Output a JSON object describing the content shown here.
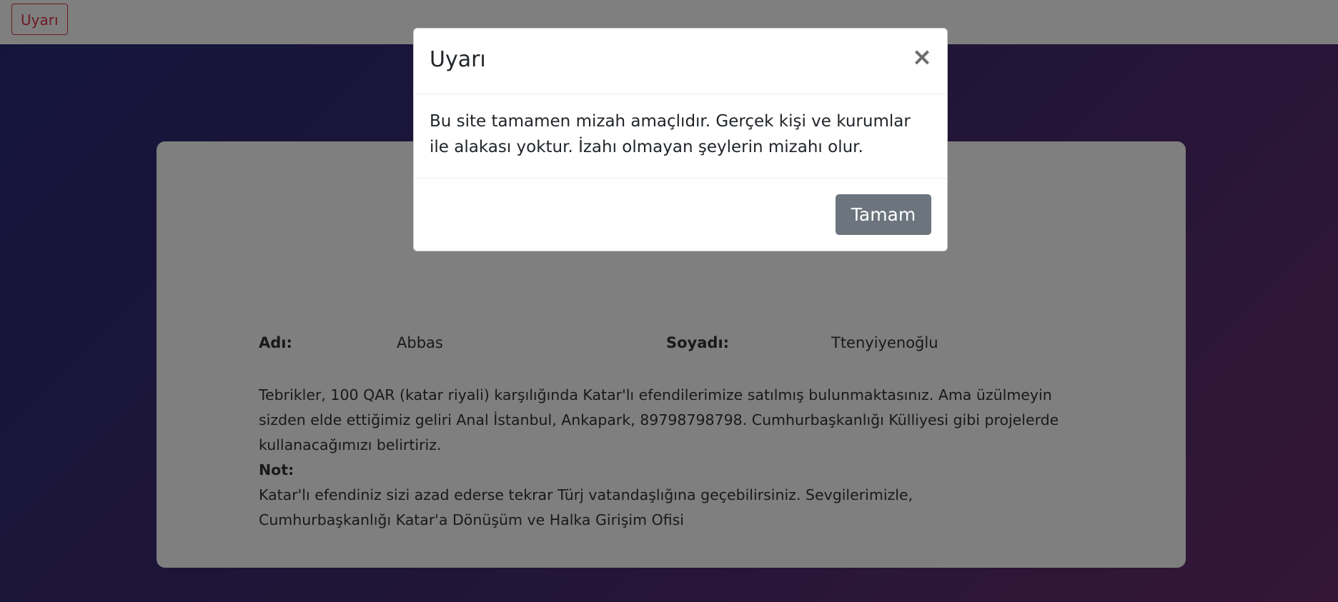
{
  "topbar": {
    "warning_button_label": "Uyarı"
  },
  "card": {
    "first_name_label": "Adı:",
    "first_name_value": "Abbas",
    "last_name_label": "Soyadı:",
    "last_name_value": "Ttenyiyenoğlu",
    "message_paragraph": "Tebrikler, 100 QAR (katar riyali) karşılığında Katar'lı efendilerimize satılmış bulunmaktasınız. Ama üzülmeyin sizden elde ettiğimiz geliri Anal İstanbul, Ankapark, 89798798798. Cumhurbaşkanlığı Külliyesi gibi projelerde kullanacağımızı belirtiriz.",
    "note_label": "Not:",
    "note_text": "Katar'lı efendiniz sizi azad ederse tekrar Türj vatandaşlığına geçebilirsiniz. Sevgilerimizle,",
    "signature": "Cumhurbaşkanlığı Katar'a Dönüşüm ve Halka Girişim Ofisi"
  },
  "modal": {
    "title": "Uyarı",
    "close_glyph": "×",
    "body": "Bu site tamamen mizah amaçlıdır. Gerçek kişi ve kurumlar ile alakası yoktur. İzahı olmayan şeylerin mizahı olur.",
    "ok_button_label": "Tamam"
  },
  "colors": {
    "danger": "#dc3545",
    "secondary_button": "#6c757d",
    "gradient_start": "#2a2a7a",
    "gradient_end": "#6b2d6e"
  }
}
